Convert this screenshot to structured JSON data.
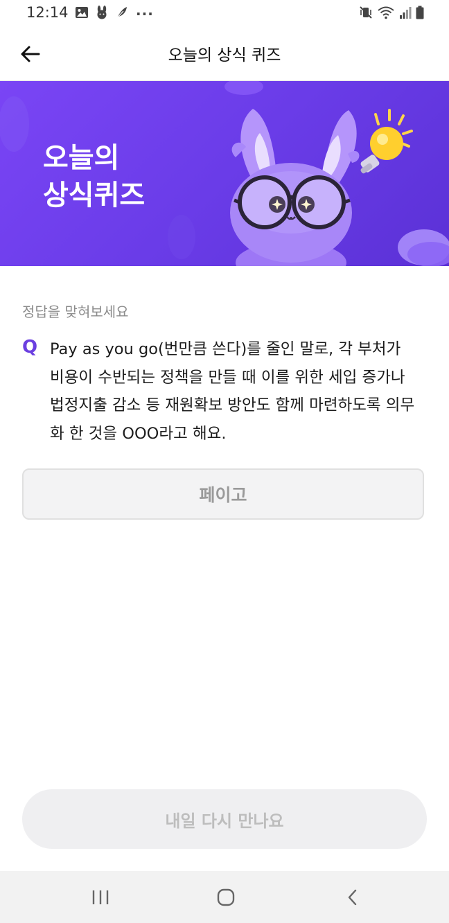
{
  "status_bar": {
    "time": "12:14",
    "more_indicator": "···",
    "left_icons": [
      "gallery-icon",
      "bunny-icon",
      "feather-icon"
    ],
    "right_icons": [
      "mute-vibrate-icon",
      "wifi-icon",
      "signal-icon",
      "battery-icon"
    ]
  },
  "header": {
    "title": "오늘의 상식 퀴즈",
    "back_icon": "arrow-left-icon"
  },
  "banner": {
    "title_line1": "오늘의",
    "title_line2": "상식퀴즈",
    "illustration": "purple-bunny-glasses-and-lightbulb",
    "background_color": "#6a3ce8"
  },
  "quiz": {
    "prompt": "정답을 맞혀보세요",
    "q_label": "Q",
    "question_lines": [
      "Pay as you go(번만큼 쓴다)를 줄인 말로, 각 부처가",
      "비용이 수반되는 정책을 만들 때 이를 위한 세입 증가나",
      "법정지출 감소 등 재원확보 방안도 함께 마련하도록 의무",
      "화 한 것을 OOO라고 해요."
    ],
    "answer": "페이고",
    "accent_color": "#6b3fe0"
  },
  "footer": {
    "button_label": "내일 다시 만나요"
  },
  "nav_bar": {
    "icons": [
      "recent-apps-icon",
      "home-icon",
      "back-icon"
    ]
  }
}
